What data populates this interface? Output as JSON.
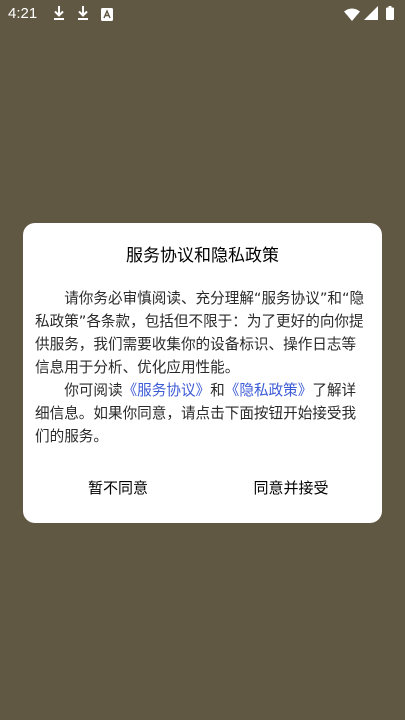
{
  "status_bar": {
    "time": "4:21",
    "icons": [
      "download-icon",
      "download-icon",
      "app-notification-icon",
      "wifi-icon",
      "signal-icon",
      "battery-icon"
    ]
  },
  "dialog": {
    "title": "服务协议和隐私政策",
    "paragraph1": "请你务必审慎阅读、充分理解“服务协议”和“隐私政策”各条款，包括但不限于：为了更好的向你提供服务，我们需要收集你的设备标识、操作日志等信息用于分析、优化应用性能。",
    "paragraph2_prefix": "你可阅读",
    "link_service": "《服务协议》",
    "paragraph2_and": "和",
    "link_privacy": "《隐私政策》",
    "paragraph2_suffix": "了解详细信息。如果你同意，请点击下面按钮开始接受我们的服务。",
    "disagree_label": "暂不同意",
    "agree_label": "同意并接受",
    "link_color": "#3c5bd6"
  },
  "colors": {
    "background": "#605843",
    "dialog": "#ffffff"
  }
}
